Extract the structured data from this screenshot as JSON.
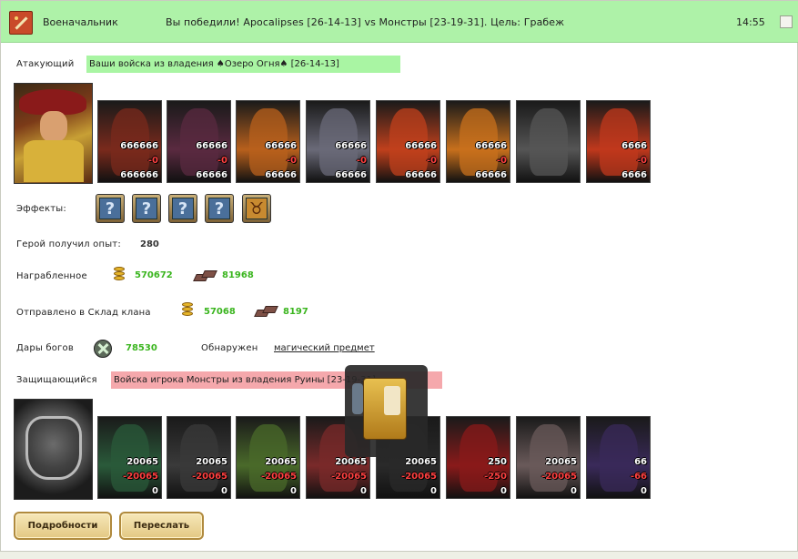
{
  "header": {
    "role": "Военачальник",
    "result": "Вы победили! Apocalipses [26-14-13] vs Монстры [23-19-31]. Цель: Грабеж",
    "time": "14:55"
  },
  "attacker": {
    "label": "Атакующий",
    "banner": "Ваши войска из владения ♠Озеро Огня♠ [26-14-13]",
    "units": [
      {
        "count": "666666",
        "lost": "-0",
        "left": "666666",
        "color": "#7a2a1c"
      },
      {
        "count": "66666",
        "lost": "-0",
        "left": "66666",
        "color": "#5a2a40"
      },
      {
        "count": "66666",
        "lost": "-0",
        "left": "66666",
        "color": "#b8601c"
      },
      {
        "count": "66666",
        "lost": "-0",
        "left": "66666",
        "color": "#6a6a78"
      },
      {
        "count": "66666",
        "lost": "-0",
        "left": "66666",
        "color": "#c0401c"
      },
      {
        "count": "66666",
        "lost": "-0",
        "left": "66666",
        "color": "#c8701c"
      },
      {
        "count": "",
        "lost": "",
        "left": "",
        "color": "#555555"
      },
      {
        "count": "6666",
        "lost": "-0",
        "left": "6666",
        "color": "#c0381c"
      }
    ]
  },
  "effects": {
    "label": "Эффекты:",
    "items": [
      {
        "glyph": "?",
        "icon": "unknown-effect-icon"
      },
      {
        "glyph": "?",
        "icon": "unknown-effect-icon"
      },
      {
        "glyph": "?",
        "icon": "unknown-effect-icon"
      },
      {
        "glyph": "?",
        "icon": "unknown-effect-icon"
      },
      {
        "glyph": "♉",
        "icon": "beast-effect-icon"
      }
    ]
  },
  "experience": {
    "label": "Герой получил опыт:",
    "value": "280"
  },
  "loot": {
    "label": "Награбленное",
    "gold": "570672",
    "ore": "81968"
  },
  "clan_storage": {
    "label": "Отправлено в Склад клана",
    "gold": "57068",
    "ore": "8197"
  },
  "gifts": {
    "label": "Дары богов",
    "value": "78530"
  },
  "found": {
    "label": "Обнаружен",
    "link": "магический предмет"
  },
  "defender": {
    "label": "Защищающийся",
    "banner": "Войска игрока Монстры из владения Руины [23-19-31]",
    "units": [
      {
        "count": "20065",
        "lost": "-20065",
        "left": "0",
        "color": "#2a5a3a"
      },
      {
        "count": "20065",
        "lost": "-20065",
        "left": "0",
        "color": "#3a3a3a"
      },
      {
        "count": "20065",
        "lost": "-20065",
        "left": "0",
        "color": "#4a6a2a"
      },
      {
        "count": "20065",
        "lost": "-20065",
        "left": "0",
        "color": "#7a2a2a"
      },
      {
        "count": "20065",
        "lost": "-20065",
        "left": "0",
        "color": "#2a2a2a"
      },
      {
        "count": "250",
        "lost": "-250",
        "left": "0",
        "color": "#8a1a1a"
      },
      {
        "count": "20065",
        "lost": "-20065",
        "left": "0",
        "color": "#6a5a5a"
      },
      {
        "count": "66",
        "lost": "-66",
        "left": "0",
        "color": "#3a2a5a"
      }
    ]
  },
  "buttons": {
    "details": "Подробности",
    "forward": "Переслать"
  },
  "colors": {
    "header_bg": "#aef2a8",
    "attacker_bar": "#a9f5a3",
    "defender_bar": "#f5a8ac",
    "green_value": "#3ab51e",
    "loss_red": "#ff4040"
  }
}
